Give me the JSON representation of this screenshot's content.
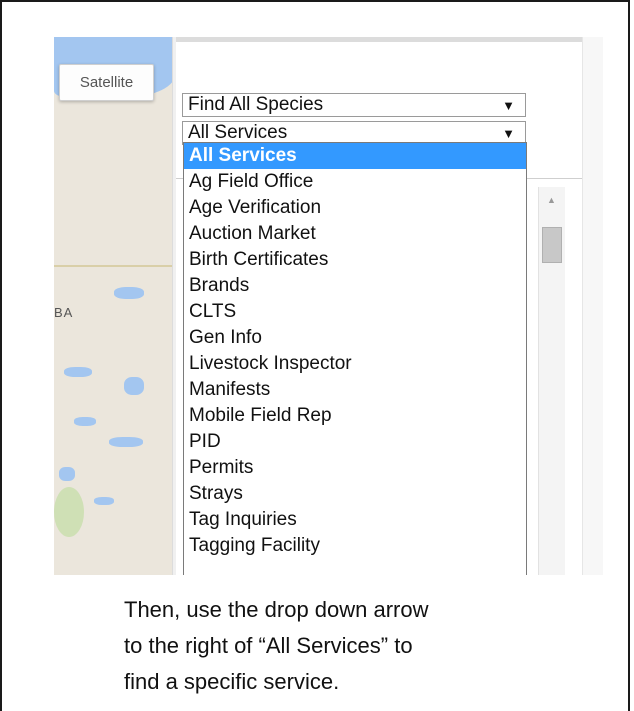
{
  "map": {
    "satellite_label": "Satellite",
    "place_label": "BA"
  },
  "filters": {
    "species_select": {
      "value": "Find All Species"
    },
    "services_select": {
      "value": "All Services"
    }
  },
  "services_dropdown": {
    "options": [
      "All Services",
      "Ag Field Office",
      "Age Verification",
      "Auction Market",
      "Birth Certificates",
      "Brands",
      "CLTS",
      "Gen Info",
      "Livestock Inspector",
      "Manifests",
      "Mobile Field Rep",
      "PID",
      "Permits",
      "Strays",
      "Tag Inquiries",
      "Tagging Facility"
    ],
    "selected": "All Services",
    "highlight_color": "#3399ff"
  },
  "caption": {
    "lines": [
      "Then, use the drop down arrow",
      "to the right of “All Services” to",
      "find a specific service."
    ]
  },
  "icons": {
    "dropdown_arrow": "▼",
    "scroll_up": "▲"
  }
}
